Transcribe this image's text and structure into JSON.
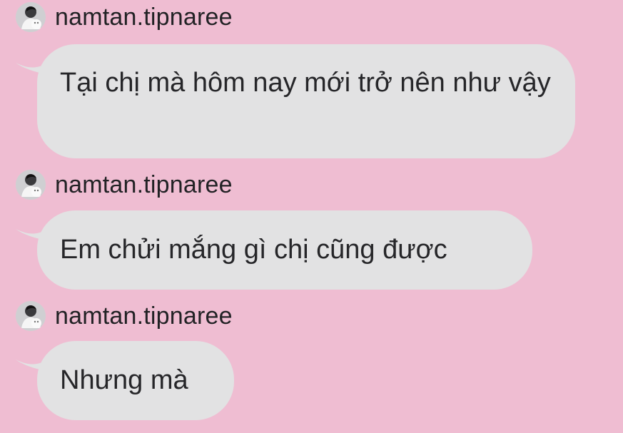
{
  "messages": [
    {
      "sender": "namtan.tipnaree",
      "text": "Tại chị mà hôm nay mới trở nên như vậy"
    },
    {
      "sender": "namtan.tipnaree",
      "text": "Em chửi mắng gì chị cũng được"
    },
    {
      "sender": "namtan.tipnaree",
      "text": "Nhưng mà"
    }
  ],
  "colors": {
    "background": "#efbdd2",
    "bubble": "#e2e2e3",
    "text": "#262629",
    "name": "#222225"
  },
  "icons": {
    "avatar": "user-avatar-icon"
  }
}
